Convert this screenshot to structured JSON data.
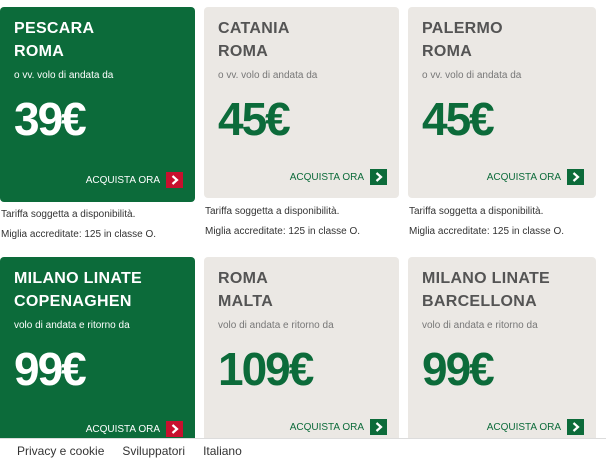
{
  "offers": [
    {
      "line1": "PESCARA",
      "line2": "ROMA",
      "subtitle": "o vv. volo di andata da",
      "price": "39€",
      "cta": "ACQUISTA ORA"
    },
    {
      "line1": "CATANIA",
      "line2": "ROMA",
      "subtitle": "o vv. volo di andata da",
      "price": "45€",
      "cta": "ACQUISTA ORA"
    },
    {
      "line1": "PALERMO",
      "line2": "ROMA",
      "subtitle": "o vv. volo di andata da",
      "price": "45€",
      "cta": "ACQUISTA ORA"
    },
    {
      "line1": "MILANO LINATE",
      "line2": "COPENAGHEN",
      "subtitle": "volo di andata e ritorno da",
      "price": "99€",
      "cta": "ACQUISTA ORA"
    },
    {
      "line1": "ROMA",
      "line2": "MALTA",
      "subtitle": "volo di andata e ritorno da",
      "price": "109€",
      "cta": "ACQUISTA ORA"
    },
    {
      "line1": "MILANO LINATE",
      "line2": "BARCELLONA",
      "subtitle": "volo di andata e ritorno da",
      "price": "99€",
      "cta": "ACQUISTA ORA"
    }
  ],
  "notes": {
    "fare": "Tariffa soggetta a disponibilità.",
    "miles": "Miglia accreditate: 125 in classe O."
  },
  "footer": {
    "privacy": "Privacy e cookie",
    "developers": "Sviluppatori",
    "language": "Italiano"
  },
  "colors": {
    "brand_green": "#0c6b3a",
    "card_grey": "#ebe8e4",
    "accent_red": "#c8102e"
  },
  "icons": {
    "cta": "chevron-right-icon"
  }
}
